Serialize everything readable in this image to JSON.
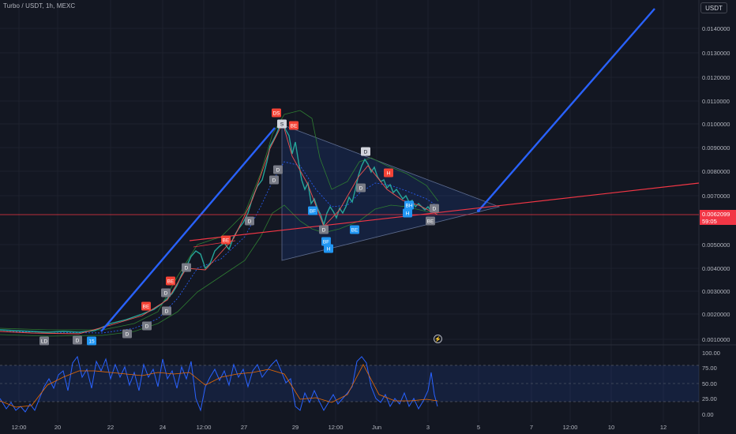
{
  "header": {
    "title": "Turbo / USDT, 1h, MEXC",
    "currency": "USDT"
  },
  "price_axis": [
    "0.0140000",
    "0.0130000",
    "0.0120000",
    "0.0110000",
    "0.0100000",
    "0.0090000",
    "0.0080000",
    "0.0070000",
    "0.0050000",
    "0.0040000",
    "0.0030000",
    "0.0020000",
    "0.0010000"
  ],
  "current_price": {
    "value": "0.0062099",
    "countdown": "59:05"
  },
  "rsi_axis": [
    "100.00",
    "75.00",
    "50.00",
    "25.00",
    "0.00"
  ],
  "time_axis": [
    "12:00",
    "20",
    "22",
    "24",
    "12:00",
    "27",
    "29",
    "12:00",
    "Jun",
    "3",
    "5",
    "7",
    "12:00",
    "10",
    "12"
  ],
  "signals": [
    "LD",
    "D",
    "15",
    "D",
    "D",
    "BE",
    "D",
    "D",
    "BE",
    "D",
    "BE",
    "D",
    "D",
    "D",
    "DS",
    "S",
    "BE",
    "BF",
    "D",
    "BF",
    "D",
    "H",
    "BE",
    "D",
    "H",
    "BH",
    "H",
    "BE",
    "D"
  ],
  "colors": {
    "background": "#131722",
    "blue_line": "#2962ff",
    "red_line": "#f23645",
    "bull_signal": "#2196f3",
    "bear_signal": "#f44336",
    "neutral_signal": "#787b86",
    "rsi": "#7e57c2"
  }
}
